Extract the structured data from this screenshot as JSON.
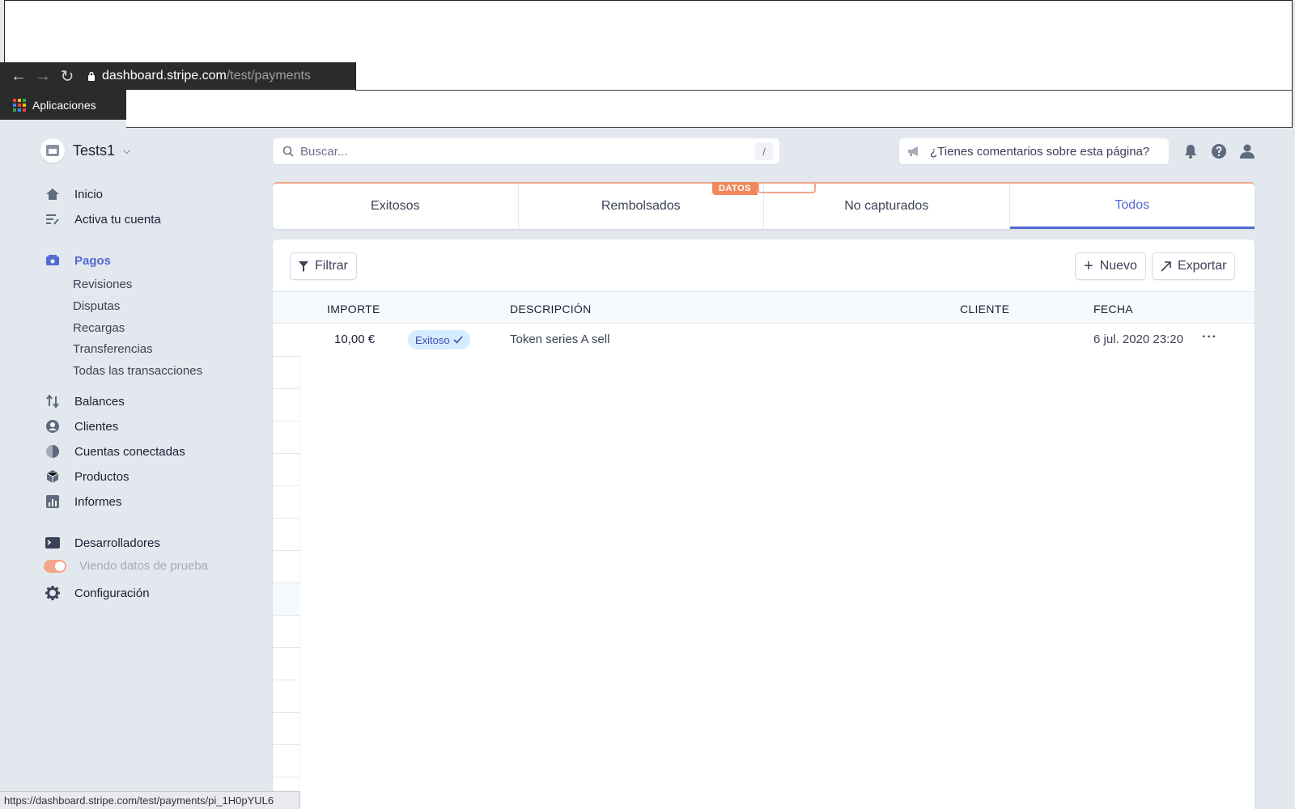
{
  "browser": {
    "url_host": "dashboard.stripe.com",
    "url_path": "/test/payments",
    "bookmarks_label": "Aplicaciones",
    "status_url": "https://dashboard.stripe.com/test/payments/pi_1H0pYUL6"
  },
  "account": {
    "name": "Tests1"
  },
  "sidebar": {
    "items": [
      {
        "label": "Inicio",
        "icon": "home-icon"
      },
      {
        "label": "Activa tu cuenta",
        "icon": "checklist-icon"
      },
      {
        "label": "Pagos",
        "icon": "payments-icon",
        "active": true
      },
      {
        "label": "Balances",
        "icon": "balances-icon"
      },
      {
        "label": "Clientes",
        "icon": "customers-icon"
      },
      {
        "label": "Cuentas conectadas",
        "icon": "connected-accounts-icon"
      },
      {
        "label": "Productos",
        "icon": "products-icon"
      },
      {
        "label": "Informes",
        "icon": "reports-icon"
      },
      {
        "label": "Desarrolladores",
        "icon": "developers-icon"
      },
      {
        "label": "Viendo datos de prueba",
        "icon": "toggle"
      },
      {
        "label": "Configuración",
        "icon": "gear-icon"
      }
    ],
    "payments_sub": [
      "Revisiones",
      "Disputas",
      "Recargas",
      "Transferencias",
      "Todas las transacciones"
    ]
  },
  "search": {
    "placeholder": "Buscar...",
    "shortcut": "/"
  },
  "feedback": {
    "label": "¿Tienes comentarios sobre esta página?"
  },
  "test_badge": "DATOS",
  "tabs": [
    {
      "label": "Exitosos"
    },
    {
      "label": "Rembolsados"
    },
    {
      "label": "No capturados"
    },
    {
      "label": "Todos",
      "active": true
    }
  ],
  "toolbar": {
    "filter_label": "Filtrar",
    "new_label": "Nuevo",
    "export_label": "Exportar"
  },
  "table": {
    "headers": {
      "amount": "IMPORTE",
      "description": "DESCRIPCIÓN",
      "customer": "CLIENTE",
      "date": "FECHA"
    },
    "rows": [
      {
        "amount": "10,00 €",
        "status": "Exitoso",
        "description": "Token series A sell",
        "customer": "",
        "date": "6 jul. 2020 23:20"
      }
    ]
  },
  "colors": {
    "accent": "#5469d4",
    "test_mode": "#f0885c",
    "background": "#e3e8ee"
  }
}
